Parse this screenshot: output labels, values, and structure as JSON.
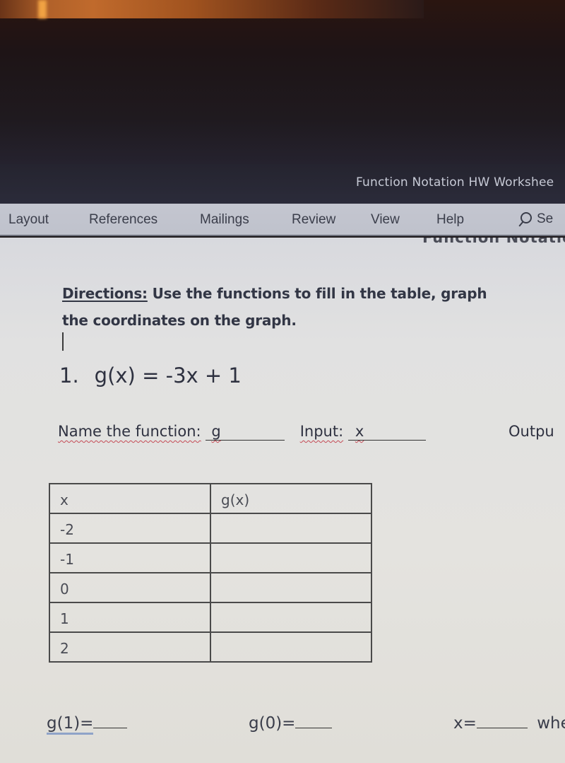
{
  "window": {
    "document_title": "Function Notation HW Workshee"
  },
  "ribbon": {
    "tabs": [
      {
        "label": "Layout"
      },
      {
        "label": "References"
      },
      {
        "label": "Mailings"
      },
      {
        "label": "Review"
      },
      {
        "label": "View"
      },
      {
        "label": "Help"
      }
    ],
    "search_label": "Se"
  },
  "document": {
    "header_partial": "Function Notatio",
    "directions_label": "Directions:",
    "directions_text_line1": " Use the functions to fill in the table, graph",
    "directions_text_line2": "the coordinates on the graph.",
    "problem_number": "1.",
    "problem_equation": "g(x) = -3x + 1",
    "name_label": "Name the function:",
    "name_value": "g",
    "input_label": "Input:",
    "input_value": "x",
    "output_label": "Outpu",
    "table": {
      "headers": [
        "x",
        "g(x)"
      ],
      "rows": [
        [
          "-2",
          ""
        ],
        [
          "-1",
          ""
        ],
        [
          "0",
          ""
        ],
        [
          "1",
          ""
        ],
        [
          "2",
          ""
        ]
      ]
    },
    "bottom": {
      "g1_label": "g(1)=",
      "g0_label": "g(0)=",
      "x_label": "x=",
      "trailing": "whe"
    }
  }
}
